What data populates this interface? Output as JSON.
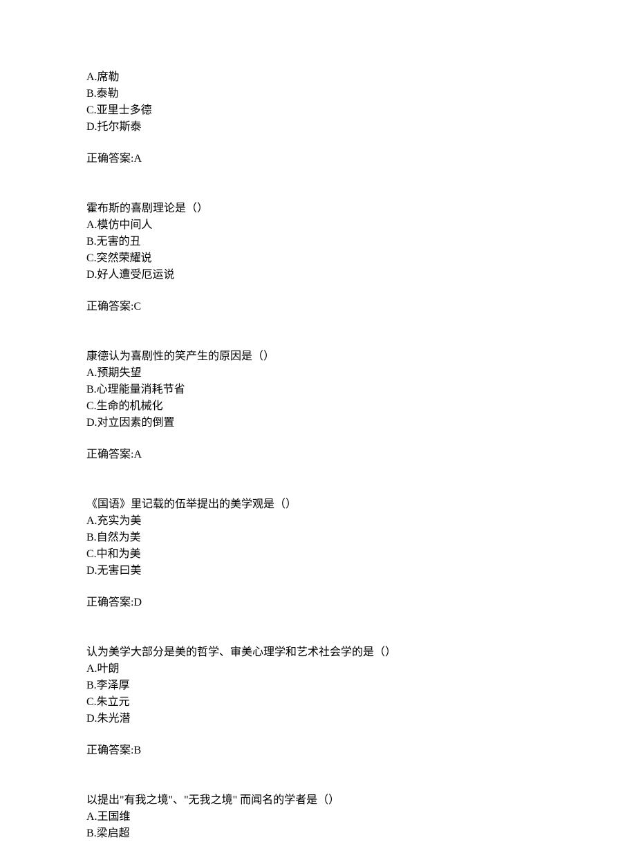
{
  "blocks": [
    {
      "question": "",
      "options": [
        "A.席勒",
        "B.泰勒",
        "C.亚里士多德",
        "D.托尔斯泰"
      ],
      "answer": "正确答案:A"
    },
    {
      "question": "霍布斯的喜剧理论是（）",
      "options": [
        "A.模仿中间人",
        "B.无害的丑",
        "C.突然荣耀说",
        "D.好人遭受厄运说"
      ],
      "answer": "正确答案:C"
    },
    {
      "question": "康德认为喜剧性的笑产生的原因是（）",
      "options": [
        "A.预期失望",
        "B.心理能量消耗节省",
        "C.生命的机械化",
        "D.对立因素的倒置"
      ],
      "answer": "正确答案:A"
    },
    {
      "question": "《国语》里记载的伍举提出的美学观是（）",
      "options": [
        "A.充实为美",
        "B.自然为美",
        "C.中和为美",
        "D.无害曰美"
      ],
      "answer": "正确答案:D"
    },
    {
      "question": "认为美学大部分是美的哲学、审美心理学和艺术社会学的是（）",
      "options": [
        "A.叶朗",
        "B.李泽厚",
        "C.朱立元",
        "D.朱光潜"
      ],
      "answer": "正确答案:B"
    },
    {
      "question": "以提出\"有我之境\"、\"无我之境\" 而闻名的学者是（）",
      "options": [
        "A.王国维",
        "B.梁启超"
      ],
      "answer": ""
    }
  ]
}
